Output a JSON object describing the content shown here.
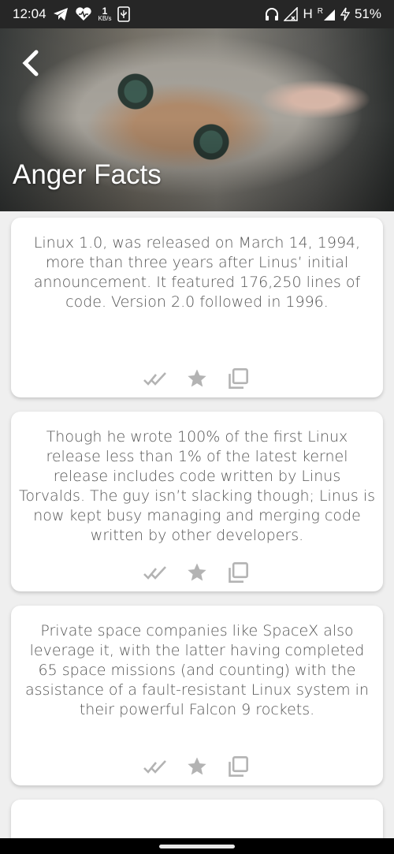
{
  "status_bar": {
    "time": "12:04",
    "net_speed_value": "1",
    "net_speed_unit": "KB/s",
    "network_label": "H",
    "roaming_label": "R",
    "battery": "51%"
  },
  "header": {
    "title": "Anger Facts",
    "image_icon": "cat-photo"
  },
  "facts": [
    {
      "text": "Linux 1.0, was released on March 14, 1994, more than three years after Linus’ initial announcement. It featured 176,250 lines of code. Version 2.0 followed in 1996."
    },
    {
      "text": "Though he wrote 100% of the first Linux release less than 1% of the latest kernel release includes code written by Linus Torvalds. The guy isn’t slacking though; Linus is now kept busy managing and merging code written by other developers."
    },
    {
      "text": "Private space companies like SpaceX also leverage it, with the latter having completed 65 space missions (and counting) with the assistance of a fault-resistant Linux system in their powerful Falcon 9 rockets."
    }
  ],
  "actions": {
    "mark_read_icon": "double-check-icon",
    "favorite_icon": "star-icon",
    "copy_icon": "copy-icon",
    "icon_color": "#b3b3b3"
  }
}
